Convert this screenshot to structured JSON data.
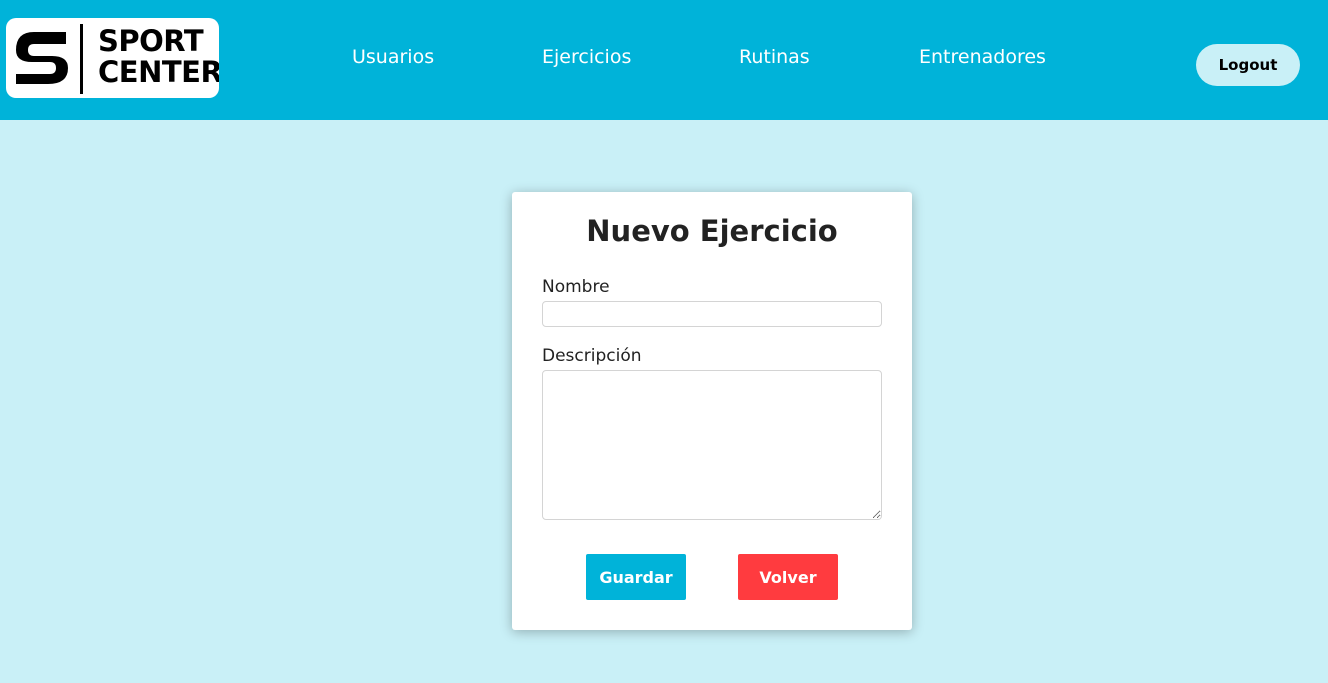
{
  "header": {
    "logo": {
      "line1": "SPORT",
      "line2": "CENTER"
    },
    "nav": {
      "usuarios": "Usuarios",
      "ejercicios": "Ejercicios",
      "rutinas": "Rutinas",
      "entrenadores": "Entrenadores"
    },
    "logout_label": "Logout"
  },
  "form": {
    "title": "Nuevo Ejercicio",
    "nombre_label": "Nombre",
    "nombre_value": "",
    "descripcion_label": "Descripción",
    "descripcion_value": "",
    "save_label": "Guardar",
    "back_label": "Volver"
  },
  "colors": {
    "header_bg": "#00b3d9",
    "page_bg": "#c9f0f7",
    "primary": "#00b3d9",
    "danger": "#ff3b3f"
  }
}
